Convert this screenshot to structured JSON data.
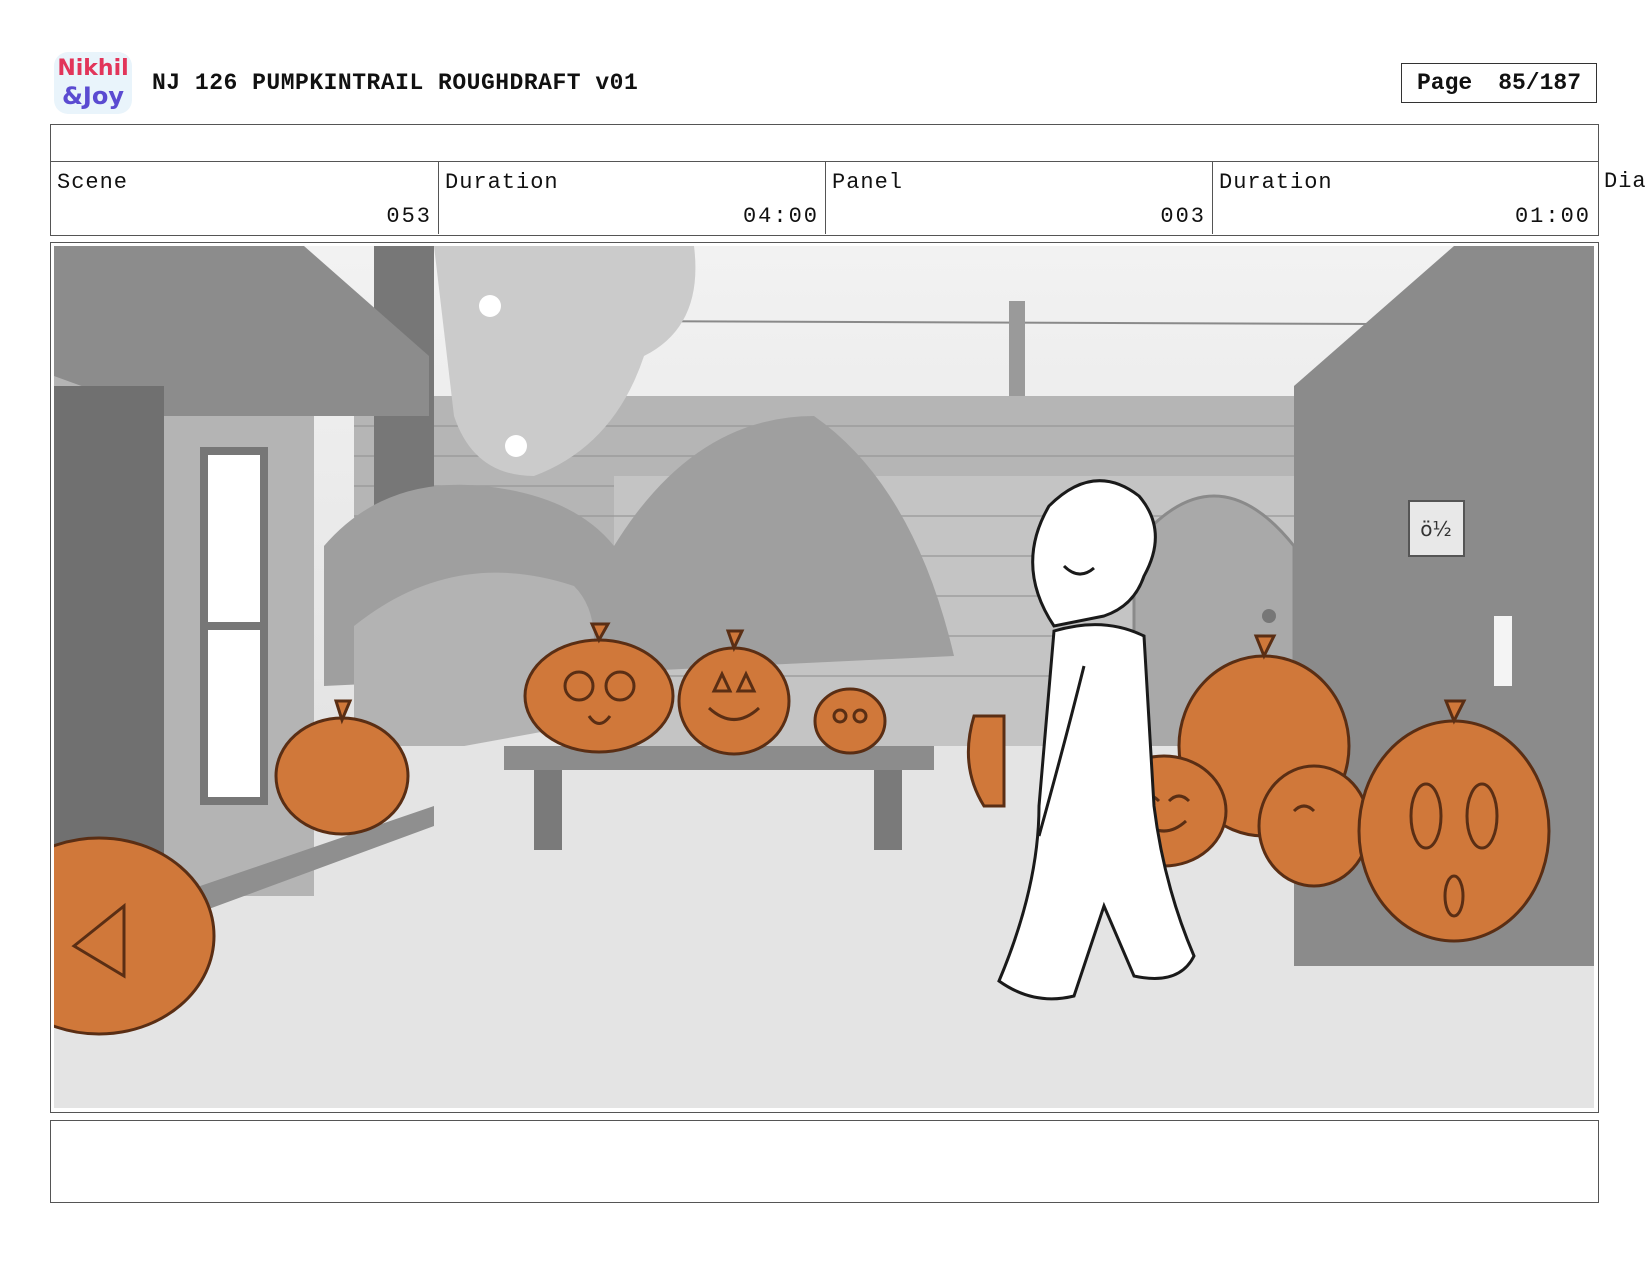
{
  "header": {
    "logo_text_line1": "Nikhil",
    "logo_text_line2": "&Joy",
    "title": "NJ 126 PUMPKINTRAIL ROUGHDRAFT v01",
    "page_label": "Page",
    "page_value": "85/187"
  },
  "info": {
    "scene_label": "Scene",
    "scene_value": "053",
    "scene_duration_label": "Duration",
    "scene_duration_value": "04:00",
    "panel_label": "Panel",
    "panel_value": "003",
    "panel_duration_label": "Duration",
    "panel_duration_value": "01:00",
    "dialogue_label_partial": "Dia"
  },
  "colors": {
    "pumpkin": "#d0783a",
    "pumpkin_outline": "#5a2e14",
    "background_gray": "#cfcfcf",
    "border": "#555555"
  },
  "illustration": {
    "scene": "backyard-with-pumpkins-and-character-walking",
    "sign_text": "ö½"
  }
}
